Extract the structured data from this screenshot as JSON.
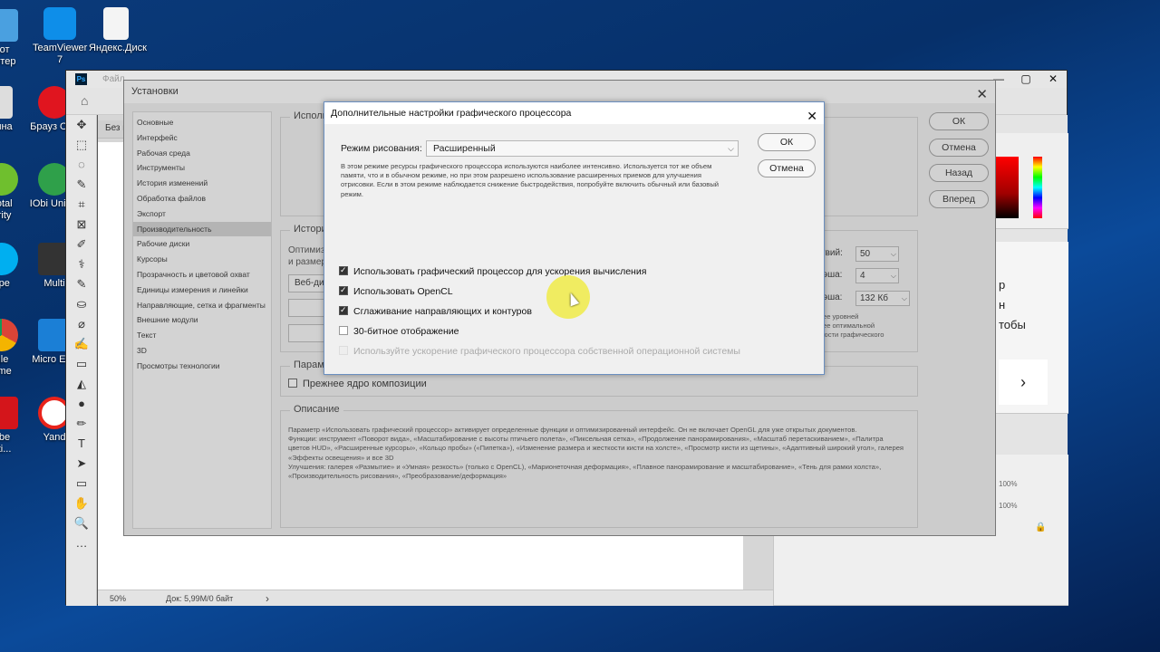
{
  "desktop": {
    "left_icons": [
      {
        "label": "рот\nьютер"
      },
      {
        "label": "зина"
      },
      {
        "label": "Total\nurity"
      },
      {
        "label": "ype"
      },
      {
        "label": "gle\nome"
      },
      {
        "label": "obe\nati..."
      }
    ],
    "icons": [
      {
        "label": "TeamViewer 7"
      },
      {
        "label": "Яндекс.Диск"
      },
      {
        "label": "Брауз Оре"
      },
      {
        "label": "IObi Uninst"
      },
      {
        "label": "Multi"
      },
      {
        "label": "Micro Edg"
      },
      {
        "label": "Yand"
      }
    ]
  },
  "photoshop": {
    "doc_tab": "Без н",
    "status_zoom": "50%",
    "status_doc": "Док: 5,99M/0 байт",
    "status_arrow": "›",
    "menu_partial": "Файл",
    "right_panel_text": [
      "р",
      "н",
      "тобы"
    ],
    "right_percent": [
      "100%",
      "100%"
    ],
    "tools": [
      "✥",
      "⬚",
      "◌",
      "✎",
      "⌗",
      "⊠",
      "✐",
      "⚕",
      "✎",
      "⛀",
      "⌀",
      "✍",
      "▭",
      "◭",
      "●",
      "✏",
      "T",
      "➤",
      "▭",
      "✋",
      "🔍",
      "…"
    ]
  },
  "preferences": {
    "title": "Установки",
    "nav": [
      {
        "label": "Основные",
        "selected": false
      },
      {
        "label": "Интерфейс",
        "selected": false
      },
      {
        "label": "Рабочая среда",
        "selected": false
      },
      {
        "label": "Инструменты",
        "selected": false
      },
      {
        "label": "История изменений",
        "selected": false
      },
      {
        "label": "Обработка файлов",
        "selected": false
      },
      {
        "label": "Экспорт",
        "selected": false
      },
      {
        "label": "Производительность",
        "selected": true
      },
      {
        "label": "Рабочие диски",
        "selected": false
      },
      {
        "label": "Курсоры",
        "selected": false
      },
      {
        "label": "Прозрачность и цветовой охват",
        "selected": false
      },
      {
        "label": "Единицы измерения и линейки",
        "selected": false
      },
      {
        "label": "Направляющие, сетка и фрагменты",
        "selected": false
      },
      {
        "label": "Внешние модули",
        "selected": false
      },
      {
        "label": "Текст",
        "selected": false
      },
      {
        "label": "3D",
        "selected": false
      },
      {
        "label": "Просмотры технологии",
        "selected": false
      }
    ],
    "buttons": {
      "ok": "ОК",
      "cancel": "Отмена",
      "back": "Назад",
      "forward": "Вперед"
    },
    "group_usage": "Использ",
    "group_history": "Истори",
    "history_text1": "Оптимиз",
    "history_text2": "и размер",
    "history_select": "Веб-ди",
    "states_label": "твий:",
    "states_value": "50",
    "cache_label": "эша:",
    "cache_value": "4",
    "tile_label": "эша:",
    "tile_value": "132 Кб",
    "note_text": "ее уровней\nее оптимальной\nюсти графического",
    "group_params": "Парам",
    "legacy_compose": "Прежнее ядро композиции",
    "desc_title": "Описание",
    "description": "Параметр «Использовать графический процессор» активирует определенные функции и оптимизированный интерфейс. Он не включает OpenGL для уже открытых документов.\nФункции: инструмент «Поворот вида», «Масштабирование с высоты птичьего полета», «Пиксельная сетка», «Продолжение панорамирования», «Масштаб перетаскиванием», «Палитра цветов HUD», «Расширенные курсоры», «Кольцо пробы» («Пипетка»), «Изменение размера и жесткости кисти на холсте», «Просмотр кисти из щетины», «Адаптивный широкий угол», галерея «Эффекты освещения» и все 3D\nУлучшения: галерея «Размытие» и «Умная» резкость» (только с OpenCL), «Марионеточная деформация», «Плавное панорамирование и масштабирование», «Тень для рамки холста», «Производительность рисования», «Преобразование/деформация»"
  },
  "gpu_dialog": {
    "title": "Дополнительные настройки графического процессора",
    "mode_label": "Режим рисования:",
    "mode_value": "Расширенный",
    "mode_desc": "В этом режиме ресурсы графического процессора используются наиболее интенсивно.  Используется тот же объем памяти, что и в обычном режиме, но при этом разрешено использование расширенных приемов для улучшения отрисовки.  Если в этом режиме наблюдается снижение быстродействия, попробуйте включить обычный или базовый режим.",
    "ok": "ОК",
    "cancel": "Отмена",
    "options": [
      {
        "label": "Использовать графический процессор для ускорения вычисления",
        "checked": true,
        "disabled": false
      },
      {
        "label": "Использовать OpenCL",
        "checked": true,
        "disabled": false
      },
      {
        "label": "Сглаживание направляющих и контуров",
        "checked": true,
        "disabled": false
      },
      {
        "label": "30-битное отображение",
        "checked": false,
        "disabled": false
      },
      {
        "label": "Используйте ускорение графического процессора собственной операционной системы",
        "checked": false,
        "disabled": true
      }
    ]
  }
}
